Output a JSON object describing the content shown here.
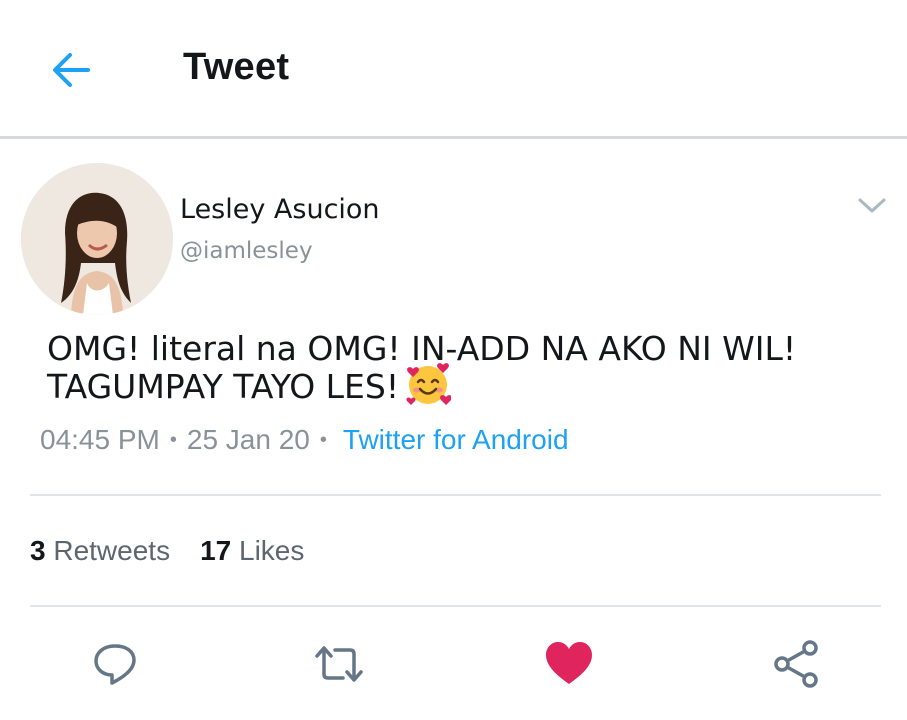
{
  "header": {
    "title": "Tweet",
    "back_icon": "arrow-left-icon"
  },
  "tweet": {
    "author_name": "Lesley Asucion",
    "author_handle": "@iamlesley",
    "text_line1": "OMG! literal na OMG! IN-ADD NA AKO NI WIL!",
    "text_line2": "TAGUMPAY TAYO LES!",
    "emoji": "smiling-face-with-hearts",
    "time": "04:45 PM",
    "date": "25 Jan 20",
    "separator": "•",
    "source": "Twitter for Android"
  },
  "stats": {
    "retweets_count": "3",
    "retweets_label": "Retweets",
    "likes_count": "17",
    "likes_label": "Likes"
  },
  "actions": [
    "reply-icon",
    "retweet-icon",
    "heart-icon",
    "share-icon"
  ],
  "colors": {
    "accent": "#1da1f2",
    "like": "#e0245e",
    "muted_text": "#8a9299",
    "divider": "#e1e5e8",
    "icon_gray": "#657786"
  }
}
